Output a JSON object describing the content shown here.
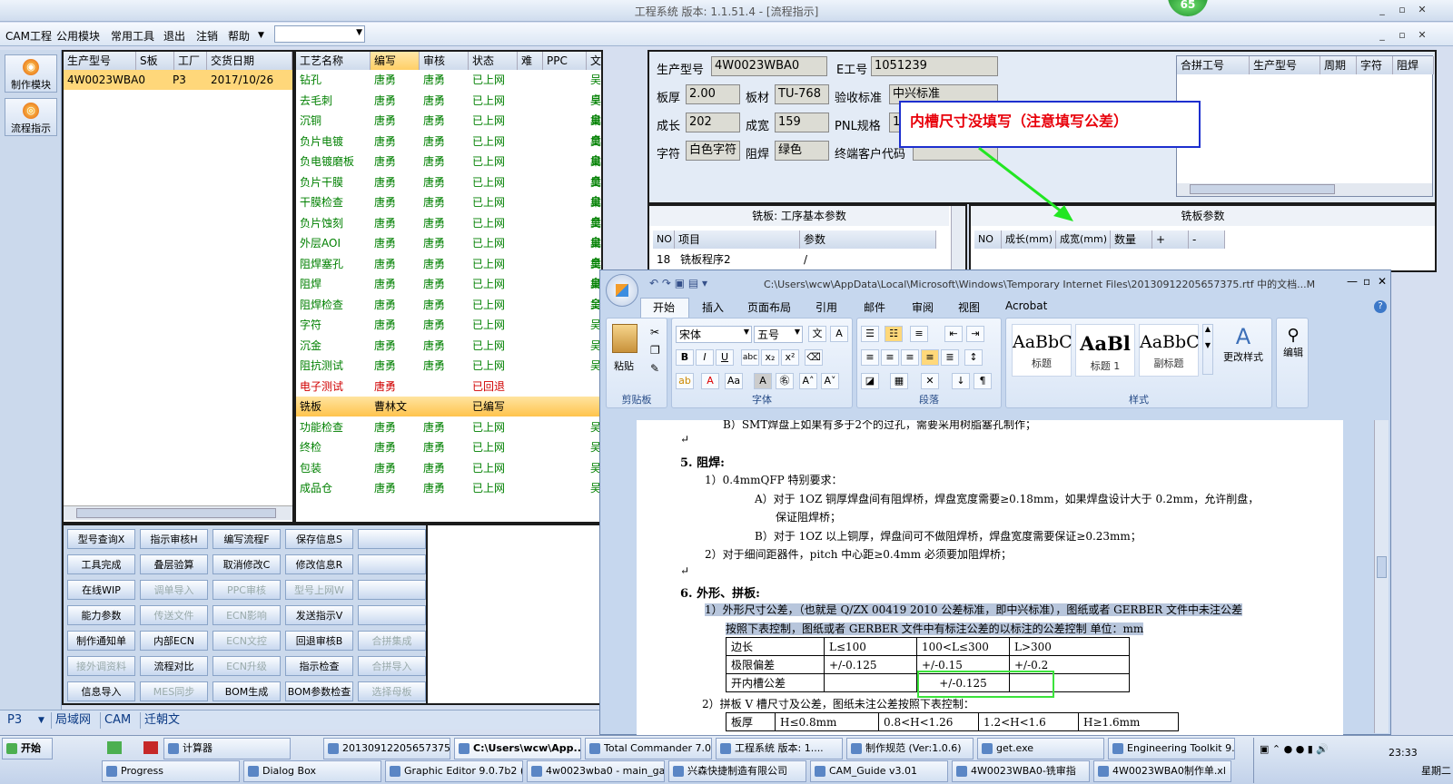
{
  "title": "工程系统  版本: 1.1.51.4 - [流程指示]",
  "badge": "65",
  "menu": [
    "CAM工程",
    "公用模块",
    "常用工具",
    "退出",
    "注销",
    "帮助"
  ],
  "side_buttons": [
    "制作模块",
    "流程指示"
  ],
  "orders": {
    "headers": [
      "生产型号",
      "S板",
      "工厂",
      "交货日期"
    ],
    "rows": [
      [
        "4W0023WBA0",
        "",
        "P3",
        "2017/10/26"
      ]
    ]
  },
  "process": {
    "headers": [
      "工艺名称",
      "编写",
      "审核",
      "状态",
      "难",
      "PPC",
      "文控"
    ],
    "rows": [
      [
        "钻孔",
        "唐勇",
        "唐勇",
        "已上网",
        "",
        "",
        "吴卓金"
      ],
      [
        "去毛刺",
        "唐勇",
        "唐勇",
        "已上网",
        "",
        "",
        "吴卓金"
      ],
      [
        "沉铜",
        "唐勇",
        "唐勇",
        "已上网",
        "",
        "",
        "吴卓金"
      ],
      [
        "负片电镀",
        "唐勇",
        "唐勇",
        "已上网",
        "",
        "",
        "吴卓金"
      ],
      [
        "负电镀磨板",
        "唐勇",
        "唐勇",
        "已上网",
        "",
        "",
        "吴卓金"
      ],
      [
        "负片干膜",
        "唐勇",
        "唐勇",
        "已上网",
        "",
        "",
        "吴卓金"
      ],
      [
        "干膜检查",
        "唐勇",
        "唐勇",
        "已上网",
        "",
        "",
        "吴卓金"
      ],
      [
        "负片蚀刻",
        "唐勇",
        "唐勇",
        "已上网",
        "",
        "",
        "吴卓金"
      ],
      [
        "外层AOI",
        "唐勇",
        "唐勇",
        "已上网",
        "",
        "",
        "吴卓金"
      ],
      [
        "阻焊塞孔",
        "唐勇",
        "唐勇",
        "已上网",
        "",
        "",
        "吴卓金"
      ],
      [
        "阻焊",
        "唐勇",
        "唐勇",
        "已上网",
        "",
        "",
        "吴"
      ],
      [
        "阻焊检查",
        "唐勇",
        "唐勇",
        "已上网",
        "",
        "",
        "吴"
      ],
      [
        "字符",
        "唐勇",
        "唐勇",
        "已上网",
        "",
        "",
        "吴"
      ],
      [
        "沉金",
        "唐勇",
        "唐勇",
        "已上网",
        "",
        "",
        "吴"
      ],
      [
        "阻抗测试",
        "唐勇",
        "唐勇",
        "已上网",
        "",
        "",
        "吴"
      ],
      [
        "电子测试",
        "唐勇",
        "",
        "已回退",
        "",
        "",
        ""
      ],
      [
        "铣板",
        "曹林文",
        "",
        "已编写",
        "",
        "",
        ""
      ],
      [
        "功能检查",
        "唐勇",
        "唐勇",
        "已上网",
        "",
        "",
        "吴"
      ],
      [
        "终检",
        "唐勇",
        "唐勇",
        "已上网",
        "",
        "",
        "吴"
      ],
      [
        "包装",
        "唐勇",
        "唐勇",
        "已上网",
        "",
        "",
        "吴"
      ],
      [
        "成品仓",
        "唐勇",
        "唐勇",
        "已上网",
        "",
        "",
        "吴"
      ]
    ]
  },
  "func_buttons": [
    [
      "型号查询X",
      "指示审核H",
      "编写流程F",
      "保存信息S",
      ""
    ],
    [
      "工具完成",
      "叠层验算",
      "取消修改C",
      "修改信息R",
      ""
    ],
    [
      "在线WIP",
      "调单导入",
      "PPC审核",
      "型号上网W",
      ""
    ],
    [
      "能力参数",
      "传送文件",
      "ECN影响",
      "发送指示V",
      ""
    ],
    [
      "制作通知单",
      "内部ECN",
      "ECN文控",
      "回退审核B",
      "合拼集成"
    ],
    [
      "接外调资料",
      "流程对比",
      "ECN升级",
      "指示检查",
      "合拼导入"
    ],
    [
      "信息导入",
      "MES同步",
      "BOM生成",
      "BOM参数检查",
      "选择母板"
    ]
  ],
  "status_tabs": [
    "P3",
    "局域网",
    "CAM",
    "迁朝文"
  ],
  "info": {
    "model_label": "生产型号",
    "model": "4W0023WBA0",
    "e_label": "E工号",
    "e_no": "1051239",
    "thick_label": "板厚",
    "thick": "2.00",
    "mat_label": "板材",
    "mat": "TU-768",
    "std_label": "验收标准",
    "std": "中兴标准",
    "len_label": "成长",
    "len": "202",
    "wid_label": "成宽",
    "wid": "159",
    "pnl_label": "PNL规格",
    "pnl": "1",
    "char_label": "字符",
    "char": "白色字符",
    "mask_label": "阻焊",
    "mask": "绿色",
    "cust_label": "终端客户代码"
  },
  "merge_headers": [
    "合拼工号",
    "生产型号",
    "周期",
    "字符",
    "阻焊"
  ],
  "mill_basic": {
    "title": "铣板: 工序基本参数",
    "headers": [
      "NO",
      "项目",
      "参数"
    ],
    "row": [
      "18",
      "铣板程序2",
      "/"
    ]
  },
  "mill_params": {
    "title": "铣板参数",
    "headers": [
      "NO",
      "成长(mm)",
      "成宽(mm)",
      "数量",
      "+",
      "-"
    ]
  },
  "callout": "内槽尺寸没填写（注意填写公差）",
  "word": {
    "title": "C:\\Users\\wcw\\AppData\\Local\\Microsoft\\Windows\\Temporary Internet Files\\20130912205657375.rtf 中的文档...M",
    "tabs": [
      "开始",
      "插入",
      "页面布局",
      "引用",
      "邮件",
      "审阅",
      "视图",
      "Acrobat"
    ],
    "paste": "粘贴",
    "font": "宋体",
    "size": "五号",
    "groups": [
      "剪贴板",
      "字体",
      "段落",
      "样式"
    ],
    "styles": [
      {
        "preview": "AaBbC",
        "name": "标题"
      },
      {
        "preview": "AaBl",
        "name": "标题 1"
      },
      {
        "preview": "AaBbC",
        "name": "副标题"
      }
    ],
    "change_style": "更改样式",
    "edit": "编辑",
    "lines": [
      "B）SMT焊盘上如果有多于2个的过孔，需要采用树脂塞孔制作；",
      "5.  阻焊:",
      "1）0.4mmQFP 特别要求：",
      "A）对于 1OZ 铜厚焊盘间有阻焊桥，焊盘宽度需要≥0.18mm，如果焊盘设计大于 0.2mm，允许削盘，",
      "保证阻焊桥；",
      "B）对于 1OZ 以上铜厚，焊盘间可不做阻焊桥，焊盘宽度需要保证≥0.23mm；",
      "2）对于细间距器件，pitch 中心距≥0.4mm 必须要加阻焊桥；",
      "6.  外形、拼板:",
      "1）外形尺寸公差，（也就是 Q/ZX 00419 2010 公差标准，即中兴标准），图纸或者 GERBER 文件中未注公差",
      "按照下表控制，图纸或者 GERBER 文件中有标注公差的以标注的公差控制  单位：mm",
      "2）拼板 V 槽尺寸及公差，图纸未注公差按照下表控制："
    ],
    "tol_table": [
      [
        "边长",
        "L≤100",
        "100<L≤300",
        "L>300"
      ],
      [
        "极限偏差",
        "+/-0.125",
        "+/-0.15",
        "+/-0.2"
      ],
      [
        "开内槽公差",
        "",
        "+/-0.125",
        ""
      ]
    ],
    "v_table": [
      "板厚",
      "H≤0.8mm",
      "0.8<H<1.26",
      "1.2<H<1.6",
      "H≥1.6mm"
    ]
  },
  "taskbar": {
    "start": "开始",
    "row1": [
      "计算器",
      "20130912205657375...",
      "C:\\Users\\wcw\\App...",
      "Total Commander 7.0...",
      "工程系统  版本: 1....",
      "制作规范 (Ver:1.0.6)",
      "get.exe",
      "Engineering Toolkit 9...."
    ],
    "row2": [
      "Progress",
      "Dialog Box",
      "Graphic Editor 9.0.7b2 (0...",
      "4w0023wba0 - main_ga...",
      "兴森快捷制造有限公司",
      "CAM_Guide v3.01",
      "4W0023WBA0-铣审指",
      "4W0023WBA0制作单.xl"
    ],
    "time": "23:33",
    "day": "星期二"
  }
}
